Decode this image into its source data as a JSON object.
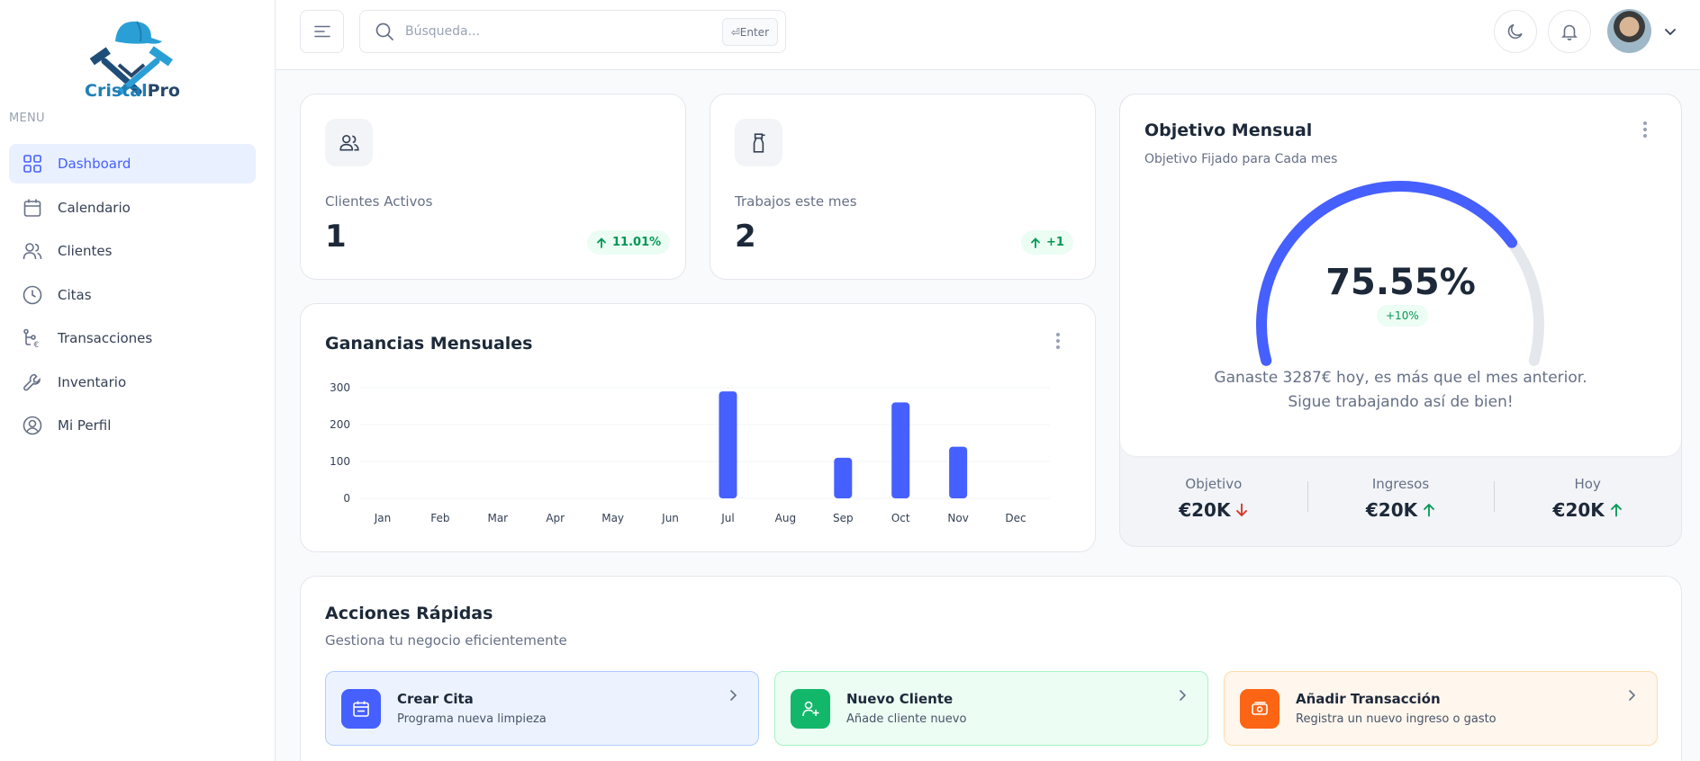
{
  "brand": {
    "name_part1": "Cristal",
    "name_part2": "Pro"
  },
  "sidebar": {
    "menu_label": "MENU",
    "items": [
      {
        "label": "Dashboard",
        "icon": "grid-icon",
        "active": true
      },
      {
        "label": "Calendario",
        "icon": "calendar-icon"
      },
      {
        "label": "Clientes",
        "icon": "users-icon"
      },
      {
        "label": "Citas",
        "icon": "clock-icon"
      },
      {
        "label": "Transacciones",
        "icon": "transactions-icon"
      },
      {
        "label": "Inventario",
        "icon": "wrench-icon"
      },
      {
        "label": "Mi Perfil",
        "icon": "user-circle-icon"
      }
    ]
  },
  "header": {
    "search_placeholder": "Búsqueda...",
    "search_shortcut": "⏎Enter"
  },
  "metrics": [
    {
      "label": "Clientes Activos",
      "value": "1",
      "badge": "11.01%",
      "icon": "users-icon"
    },
    {
      "label": "Trabajos este mes",
      "value": "2",
      "badge": "+1",
      "icon": "spray-bottle-icon"
    }
  ],
  "earnings": {
    "title": "Ganancias Mensuales"
  },
  "chart_data": {
    "type": "bar",
    "title": "Ganancias Mensuales",
    "categories": [
      "Jan",
      "Feb",
      "Mar",
      "Apr",
      "May",
      "Jun",
      "Jul",
      "Aug",
      "Sep",
      "Oct",
      "Nov",
      "Dec"
    ],
    "values": [
      0,
      0,
      0,
      0,
      0,
      0,
      290,
      0,
      110,
      260,
      140,
      0
    ],
    "ylim": [
      0,
      300
    ],
    "yticks": [
      0,
      100,
      200,
      300
    ],
    "grid": true,
    "color": "#465fff"
  },
  "objective": {
    "title": "Objetivo Mensual",
    "subtitle": "Objetivo Fijado para Cada mes",
    "percent_label": "75.55%",
    "percent": 75.55,
    "badge": "+10%",
    "message": "Ganaste 3287€ hoy, es más que el mes anterior. Sigue trabajando así de bien!",
    "stats": [
      {
        "label": "Objetivo",
        "value": "€20K",
        "trend": "down"
      },
      {
        "label": "Ingresos",
        "value": "€20K",
        "trend": "up"
      },
      {
        "label": "Hoy",
        "value": "€20K",
        "trend": "up"
      }
    ],
    "colors": {
      "fill": "#465fff",
      "track": "#e4e7ec"
    }
  },
  "quick_actions": {
    "title": "Acciones Rápidas",
    "subtitle": "Gestiona tu negocio eficientemente",
    "items": [
      {
        "title": "Crear Cita",
        "subtitle": "Programa nueva limpieza",
        "icon": "calendar-icon",
        "bg": "#ecf3ff",
        "border": "#b2ccff",
        "icon_bg": "#465fff"
      },
      {
        "title": "Nuevo Cliente",
        "subtitle": "Añade cliente nuevo",
        "icon": "user-plus-icon",
        "bg": "#ecfdf3",
        "border": "#a6f4c5",
        "icon_bg": "#12b76a"
      },
      {
        "title": "Añadir Transacción",
        "subtitle": "Registra un nuevo ingreso o gasto",
        "icon": "money-icon",
        "bg": "#fff6ed",
        "border": "#fddcab",
        "icon_bg": "#fb6514"
      }
    ]
  }
}
